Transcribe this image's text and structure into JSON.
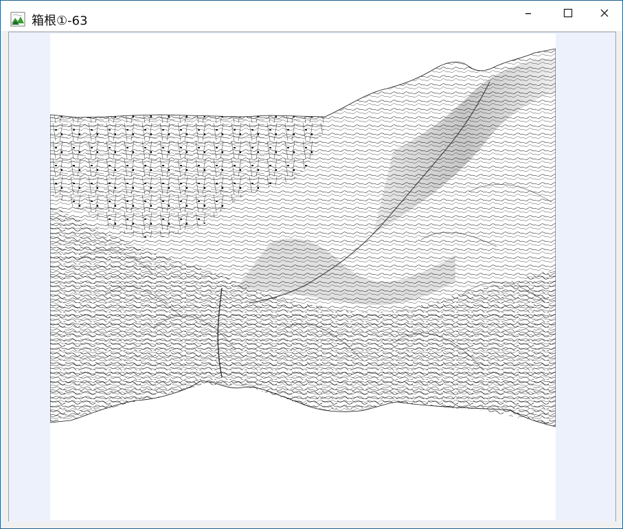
{
  "window": {
    "title": "箱根①-63",
    "controls": {
      "minimize": "minimize",
      "maximize": "maximize",
      "close": "close"
    }
  },
  "icons": {
    "app": "terrain-map-icon",
    "minimize": "minimize-icon",
    "maximize": "maximize-icon",
    "close": "close-icon"
  },
  "colors": {
    "window_border": "#1f5f8f",
    "client_background": "#edf1fb",
    "map_background": "#ffffff",
    "line_color": "#111111"
  }
}
